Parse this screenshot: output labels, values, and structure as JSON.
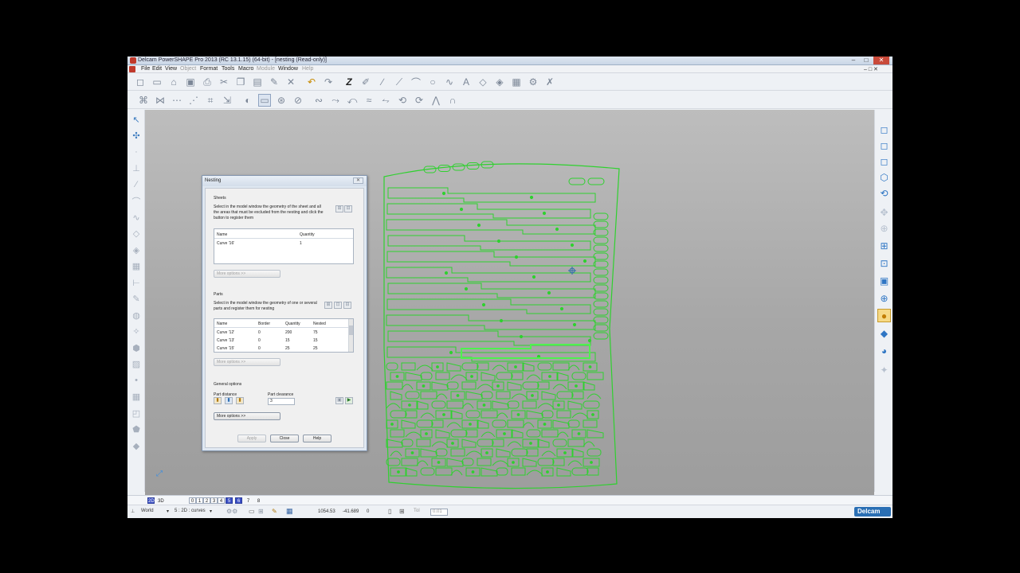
{
  "window": {
    "title": "Delcam PowerSHAPE Pro 2013 (RC 13.1.15) (64-bit) - [nesting (Read-only)]",
    "min_glyph": "–",
    "max_glyph": "□",
    "close_glyph": "✕"
  },
  "menu": {
    "items": [
      {
        "label": "File",
        "enabled": true
      },
      {
        "label": "Edit",
        "enabled": true
      },
      {
        "label": "View",
        "enabled": true
      },
      {
        "label": "Object",
        "enabled": false
      },
      {
        "label": "Format",
        "enabled": true
      },
      {
        "label": "Tools",
        "enabled": true
      },
      {
        "label": "Macro",
        "enabled": true
      },
      {
        "label": "Module",
        "enabled": false
      },
      {
        "label": "Window",
        "enabled": true
      },
      {
        "label": "Help",
        "enabled": false
      }
    ],
    "mdi_controls": "–  □  ✕"
  },
  "toolbar1": {
    "icons": [
      {
        "name": "new-icon",
        "glyph": "◻"
      },
      {
        "name": "open-icon",
        "glyph": "▭"
      },
      {
        "name": "open-folder-icon",
        "glyph": "⌂"
      },
      {
        "name": "save-icon",
        "glyph": "▣"
      },
      {
        "name": "print-icon",
        "glyph": "⎙"
      },
      {
        "name": "cut-icon",
        "glyph": "✂"
      },
      {
        "name": "copy-icon",
        "glyph": "❐"
      },
      {
        "name": "paste-icon",
        "glyph": "▤"
      },
      {
        "name": "edit-icon",
        "glyph": "✎"
      },
      {
        "name": "delete-icon",
        "glyph": "✕"
      },
      {
        "name": "undo-icon",
        "glyph": "↶",
        "state": "active"
      },
      {
        "name": "redo-icon",
        "glyph": "↷"
      },
      {
        "name": "z-axis-icon",
        "glyph": "Z",
        "state": "strong"
      },
      {
        "name": "sketch-icon",
        "glyph": "✐"
      },
      {
        "name": "line-icon",
        "glyph": "∕"
      },
      {
        "name": "polyline-icon",
        "glyph": "⟋"
      },
      {
        "name": "arc-icon",
        "glyph": "⌒"
      },
      {
        "name": "circle-icon",
        "glyph": "○"
      },
      {
        "name": "curve-icon",
        "glyph": "∿"
      },
      {
        "name": "text-icon",
        "glyph": "A"
      },
      {
        "name": "surface-icon",
        "glyph": "◇"
      },
      {
        "name": "solid-icon",
        "glyph": "◈"
      },
      {
        "name": "mesh-icon",
        "glyph": "▦"
      },
      {
        "name": "assembly-icon",
        "glyph": "⚙"
      },
      {
        "name": "tools-icon",
        "glyph": "✗"
      }
    ]
  },
  "toolbar2": {
    "icons": [
      {
        "name": "curve-edit-icon",
        "glyph": "⌘"
      },
      {
        "name": "curve-trim-icon",
        "glyph": "⋈"
      },
      {
        "name": "curve-join-icon",
        "glyph": "⋯"
      },
      {
        "name": "curve-offset-icon",
        "glyph": "⋰"
      },
      {
        "name": "curve-fillet-icon",
        "glyph": "⌗"
      },
      {
        "name": "curve-project-icon",
        "glyph": "⇲"
      },
      {
        "name": "nesting-icon",
        "glyph": "◐"
      },
      {
        "name": "nesting-sheet-icon",
        "glyph": "▭",
        "state": "pressed"
      },
      {
        "name": "nesting-part-icon",
        "glyph": "⊛"
      },
      {
        "name": "curve-split-icon",
        "glyph": "⊘"
      },
      {
        "name": "curve-blend-icon",
        "glyph": "∾"
      },
      {
        "name": "curve-extend-icon",
        "glyph": "⤳"
      },
      {
        "name": "curve-reverse-icon",
        "glyph": "⤺"
      },
      {
        "name": "curve-smooth-icon",
        "glyph": "≈"
      },
      {
        "name": "curve-wrap-icon",
        "glyph": "⥊"
      },
      {
        "name": "curve-rebuild-icon",
        "glyph": "⟲"
      },
      {
        "name": "curve-fix-icon",
        "glyph": "⟳"
      },
      {
        "name": "curve-analyze-icon",
        "glyph": "⋀"
      },
      {
        "name": "curve-arch-icon",
        "glyph": "∩"
      }
    ]
  },
  "left_toolbar": {
    "icons": [
      {
        "name": "select-arrow-icon",
        "glyph": "↖",
        "on": true
      },
      {
        "name": "quick-select-icon",
        "glyph": "✣",
        "on": true
      },
      {
        "name": "selection-divider-icon",
        "glyph": "·"
      },
      {
        "name": "workplane-icon",
        "glyph": "⊥"
      },
      {
        "name": "line-tool-icon",
        "glyph": "∕"
      },
      {
        "name": "arc-tool-icon",
        "glyph": "⌒"
      },
      {
        "name": "curve-tool-icon",
        "glyph": "∿"
      },
      {
        "name": "surface-tool-icon",
        "glyph": "◇"
      },
      {
        "name": "solid-tool-icon",
        "glyph": "◈"
      },
      {
        "name": "mesh-tool-icon",
        "glyph": "▦"
      },
      {
        "name": "dimension-tool-icon",
        "glyph": "⊢"
      },
      {
        "name": "annotation-tool-icon",
        "glyph": "✎"
      },
      {
        "name": "feature-tool-icon",
        "glyph": "◍"
      },
      {
        "name": "symbol-tool-icon",
        "glyph": "✧"
      },
      {
        "name": "electrode-tool-icon",
        "glyph": "⬢"
      },
      {
        "name": "hatch-tool-icon",
        "glyph": "▨"
      },
      {
        "name": "point-tool-icon",
        "glyph": "•"
      },
      {
        "name": "grid-tool-icon",
        "glyph": "▦"
      },
      {
        "name": "cube-tool-icon",
        "glyph": "◰"
      },
      {
        "name": "shape-tool-icon",
        "glyph": "⬟"
      },
      {
        "name": "flatten-tool-icon",
        "glyph": "◆"
      }
    ]
  },
  "right_toolbar": {
    "icons": [
      {
        "name": "view-top-icon",
        "glyph": "◻"
      },
      {
        "name": "view-front-icon",
        "glyph": "◻"
      },
      {
        "name": "view-side-icon",
        "glyph": "◻"
      },
      {
        "name": "view-iso-icon",
        "glyph": "⬡"
      },
      {
        "name": "view-rotate-icon",
        "glyph": "⟲"
      },
      {
        "name": "view-pan-icon",
        "glyph": "✥",
        "dis": true
      },
      {
        "name": "view-zoom-icon",
        "glyph": "⊕",
        "dis": true
      },
      {
        "name": "zoom-box-icon",
        "glyph": "⊞"
      },
      {
        "name": "zoom-fit-icon",
        "glyph": "⊡"
      },
      {
        "name": "zoom-selected-icon",
        "glyph": "▣"
      },
      {
        "name": "globe-icon",
        "glyph": "⊕"
      },
      {
        "name": "shaded-sphere-icon",
        "glyph": "●",
        "sel": true
      },
      {
        "name": "shaded-diamond-icon",
        "glyph": "◆"
      },
      {
        "name": "shaded-object-icon",
        "glyph": "◕"
      },
      {
        "name": "render-icon",
        "glyph": "✦",
        "dis": true
      }
    ]
  },
  "dialog": {
    "title": "Nesting",
    "close_glyph": "✕",
    "sheets": {
      "heading": "Sheets",
      "instruction": "Select in the model window the geometry of the sheet and all the areas that must be excluded from the nesting and click the button to register them",
      "columns": [
        "Name",
        "Quantity"
      ],
      "rows": [
        [
          "Curve '16'",
          "1"
        ]
      ],
      "more_options": "More options >>"
    },
    "parts": {
      "heading": "Parts",
      "instruction": "Select in the model window the geometry of one or several parts and register them for nesting",
      "columns": [
        "Name",
        "Border",
        "Quantity",
        "Nested"
      ],
      "rows": [
        [
          "Curve '12'",
          "0",
          "200",
          "75"
        ],
        [
          "Curve '13'",
          "0",
          "15",
          "15"
        ],
        [
          "Curve '15'",
          "0",
          "25",
          "25"
        ]
      ],
      "more_options": "More options >>"
    },
    "general": {
      "heading": "General options",
      "part_distance_label": "Part distance",
      "part_clearance_label": "Part clearance",
      "part_clearance_value": "3",
      "more_options": "More options >>"
    },
    "buttons": {
      "apply": "Apply",
      "close": "Close",
      "help": "Help"
    }
  },
  "status_bar": {
    "layers": [
      {
        "label": "2D",
        "style": "blue"
      },
      {
        "label": "3D",
        "style": "flat"
      },
      {
        "label": "0",
        "style": "box"
      },
      {
        "label": "1",
        "style": "box"
      },
      {
        "label": "2",
        "style": "box"
      },
      {
        "label": "3",
        "style": "box"
      },
      {
        "label": "4",
        "style": "box"
      },
      {
        "label": "5",
        "style": "blue"
      },
      {
        "label": "6",
        "style": "blue"
      },
      {
        "label": "7",
        "style": "flat"
      },
      {
        "label": "8",
        "style": "flat"
      }
    ],
    "workplane": "World",
    "level": "5 : 2D : curves",
    "x": "1054.53",
    "y": "-41.689",
    "z": "0",
    "tol_label": "Tol",
    "tol": "0.01",
    "logo": "Delcam"
  },
  "colors": {
    "nest_geometry": "#2fd12f",
    "viewport_top": "#bdbdbd",
    "viewport_bottom": "#9d9d9d",
    "layer_highlight": "#3a4fc5"
  }
}
